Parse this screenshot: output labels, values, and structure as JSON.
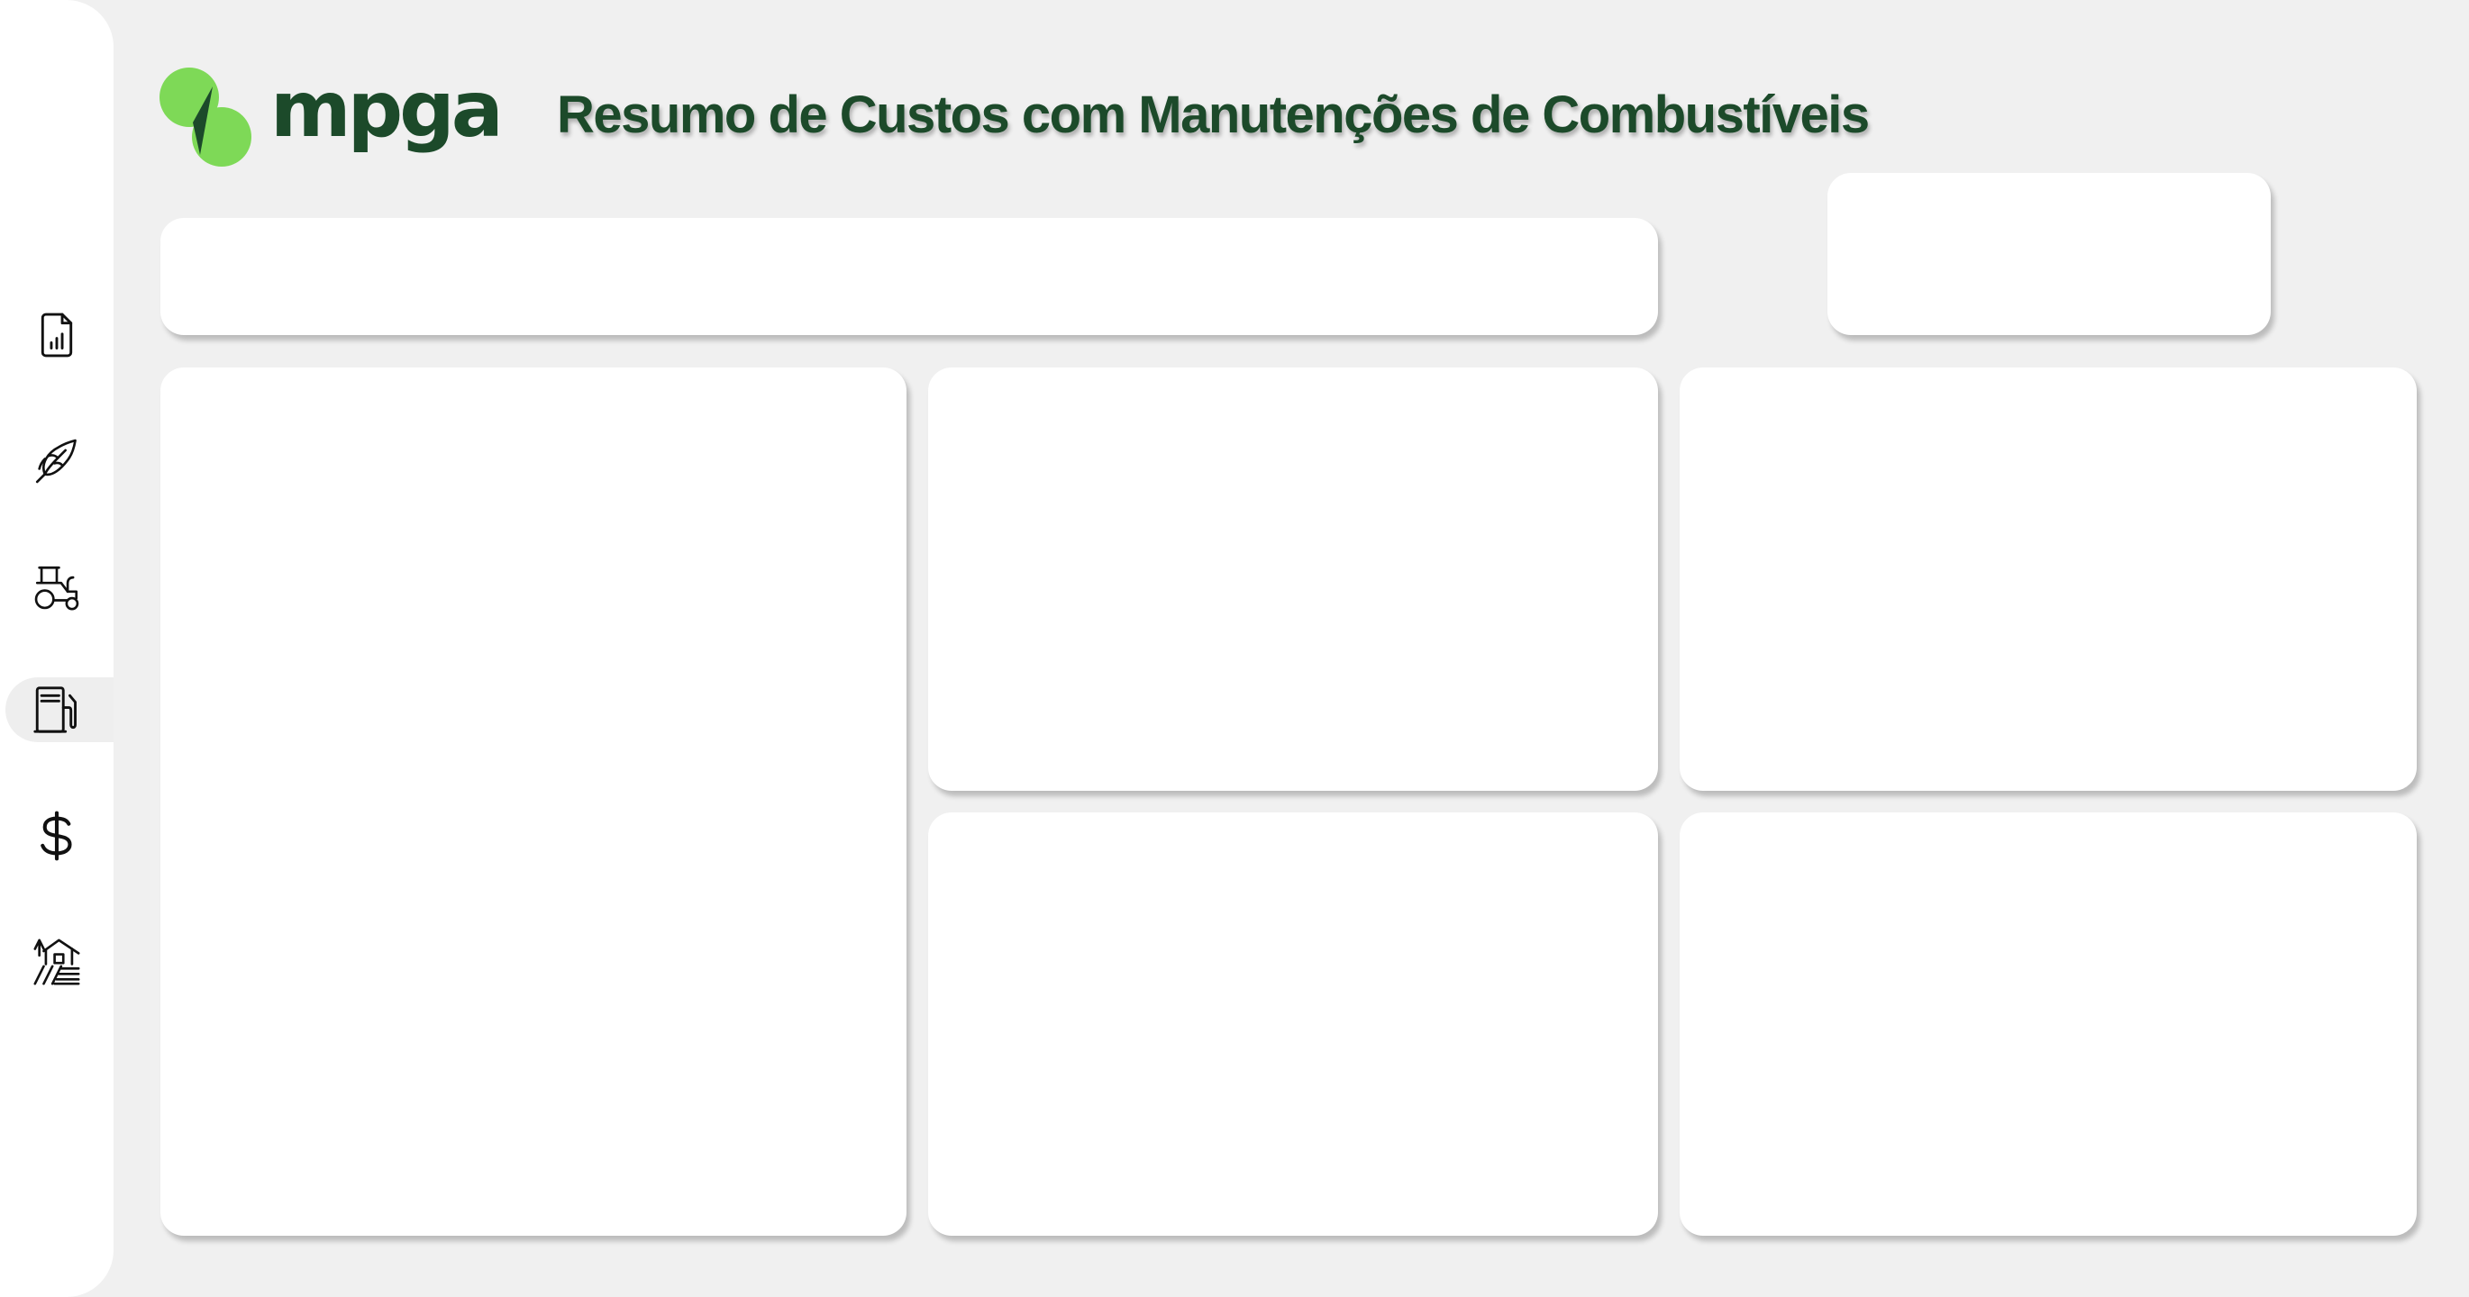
{
  "brand": {
    "name": "mpga",
    "logo_icon": "mpga-leaf-logo-icon",
    "colors": {
      "leaf": "#7ed957",
      "text": "#1c4a2a",
      "accent_dark": "#1c4a2a"
    }
  },
  "header": {
    "title": "Resumo de Custos com Manutenções de Combustíveis"
  },
  "sidebar": {
    "active_item": "fuel",
    "items": [
      {
        "id": "reports",
        "icon": "report-chart-icon"
      },
      {
        "id": "agriculture",
        "icon": "corn-icon"
      },
      {
        "id": "machinery",
        "icon": "tractor-icon"
      },
      {
        "id": "fuel",
        "icon": "fuel-pump-icon"
      },
      {
        "id": "finance",
        "icon": "dollar-icon"
      },
      {
        "id": "farm",
        "icon": "farm-house-icon"
      }
    ]
  },
  "panels": {
    "filter_bar": "filter-bar",
    "kpi_card": "kpi-card",
    "visuals": [
      "visual-left-tall",
      "visual-center-top",
      "visual-right-top",
      "visual-center-bottom",
      "visual-right-bottom"
    ]
  }
}
